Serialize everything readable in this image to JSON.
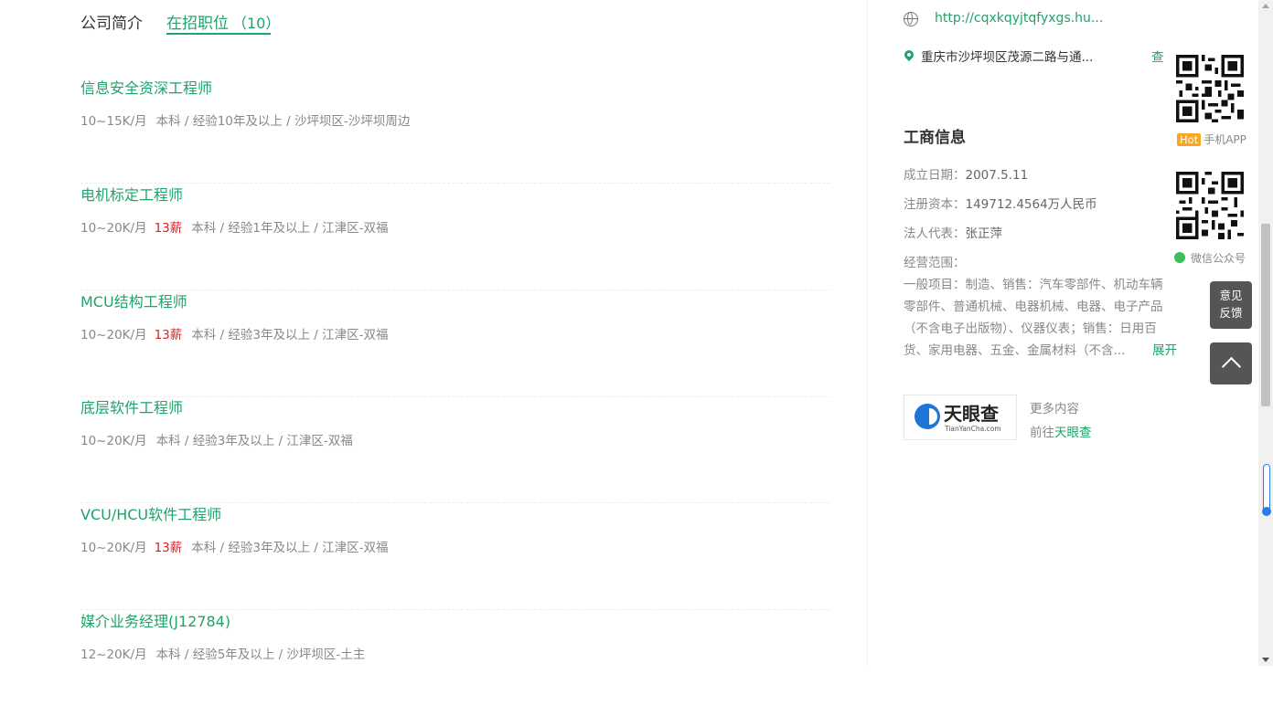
{
  "tabs": {
    "intro_label": "公司简介",
    "jobs_label": "在招职位",
    "jobs_count": "（10）"
  },
  "jobs": [
    {
      "title": "信息安全资深工程师",
      "salary": "10~15K/月",
      "bonus": "",
      "details": "本科 / 经验10年及以上 / 沙坪坝区-沙坪坝周边"
    },
    {
      "title": "电机标定工程师",
      "salary": "10~20K/月",
      "bonus": "13薪",
      "details": "本科 / 经验1年及以上 / 江津区-双福"
    },
    {
      "title": "MCU结构工程师",
      "salary": "10~20K/月",
      "bonus": "13薪",
      "details": "本科 / 经验3年及以上 / 江津区-双福"
    },
    {
      "title": "底层软件工程师",
      "salary": "10~20K/月",
      "bonus": "",
      "details": "本科 / 经验3年及以上 / 江津区-双福"
    },
    {
      "title": "VCU/HCU软件工程师",
      "salary": "10~20K/月",
      "bonus": "13薪",
      "details": "本科 / 经验3年及以上 / 江津区-双福"
    },
    {
      "title": "媒介业务经理(J12784)",
      "salary": "12~20K/月",
      "bonus": "",
      "details": "本科 / 经验5年及以上 / 沙坪坝区-土主"
    }
  ],
  "sidebar": {
    "website": "http://cqxkqyjtqfyxgs.hu...",
    "address": "重庆市沙坪坝区茂源二路与通...",
    "view_label": "查",
    "qr_app_label": "手机APP",
    "hot_badge": "Hot",
    "qr_wechat_label": "微信公众号",
    "business": {
      "title": "工商信息",
      "founded_label": "成立日期：",
      "founded_value": "2007.5.11",
      "capital_label": "注册资本：",
      "capital_value": "149712.4564万人民币",
      "legal_label": "法人代表：",
      "legal_value": "张正萍",
      "scope_label": "经营范围：",
      "scope_text": "一般项目：制造、销售：汽车零部件、机动车辆零部件、普通机械、电器机械、电器、电子产品（不含电子出版物）、仪器仪表；销售：日用百货、家用电器、五金、金属材料（不含...",
      "expand_label": "展开"
    },
    "tianyancha": {
      "logo_cn": "天眼查",
      "logo_en": "TianYanCha.com",
      "more_label": "更多内容",
      "go_prefix": "前往",
      "go_link": "天眼查"
    }
  },
  "floating": {
    "feedback_line1": "意见",
    "feedback_line2": "反馈"
  },
  "colors": {
    "accent": "#1fa36a",
    "bonus": "#e02020",
    "float_bg": "#555555"
  }
}
